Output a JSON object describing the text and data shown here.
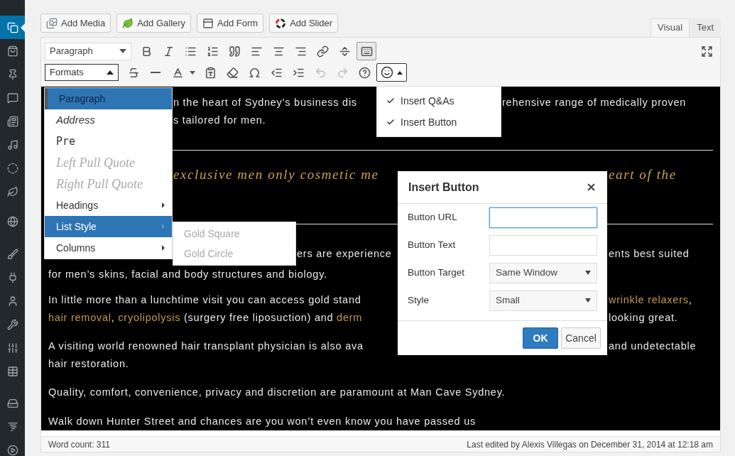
{
  "sidebar_menu": [
    {
      "selected": true
    },
    {
      "selected": false
    },
    {
      "selected": false
    },
    {
      "selected": false
    },
    {
      "selected": false
    },
    {
      "selected": false
    },
    {
      "selected": false
    },
    {
      "selected": false
    },
    {
      "selected": false
    },
    {
      "selected": false
    },
    {
      "selected": false
    },
    {
      "selected": false
    },
    {
      "selected": false
    },
    {
      "selected": false
    },
    {
      "selected": false
    },
    {
      "selected": false
    },
    {
      "selected": false
    },
    {
      "selected": false
    }
  ],
  "media_buttons": [
    "Add Media",
    "Add Gallery",
    "Add Form",
    "Add Slider"
  ],
  "editor_tabs": [
    {
      "label": "Visual",
      "selected": true
    },
    {
      "label": "Text",
      "selected": false
    }
  ],
  "toolbar": {
    "block_format": "Paragraph",
    "toolbar_toggle_pressed": true,
    "formats_select": {
      "label": "Formats",
      "open": true
    },
    "undo_disabled": true,
    "redo_disabled": true,
    "shortcodes_menu_open": true
  },
  "formats_menu": {
    "items": [
      {
        "label": "Paragraph",
        "kind": "paragraph",
        "selected": true,
        "highlighted": true
      },
      {
        "label": "Address",
        "kind": "address",
        "selected": false,
        "highlighted": false
      },
      {
        "label": "Pre",
        "kind": "pre",
        "selected": false,
        "highlighted": false
      },
      {
        "label": "Left Pull Quote",
        "kind": "pullquote",
        "selected": false,
        "highlighted": false
      },
      {
        "label": "Right Pull Quote",
        "kind": "pullquote",
        "selected": false,
        "highlighted": false
      },
      {
        "label": "Headings",
        "kind": "submenu",
        "selected": false,
        "highlighted": false
      },
      {
        "label": "List Style",
        "kind": "submenu",
        "selected": false,
        "highlighted": true
      },
      {
        "label": "Columns",
        "kind": "submenu",
        "selected": false,
        "highlighted": false
      }
    ]
  },
  "list_style_submenu": {
    "items": [
      {
        "label": "Gold Square",
        "disabled": true
      },
      {
        "label": "Gold Circle",
        "disabled": true
      }
    ]
  },
  "shortcodes_menu": {
    "items": [
      {
        "label": "Insert Q&As",
        "checked": true
      },
      {
        "label": "Insert Button",
        "checked": true
      }
    ]
  },
  "content": {
    "lines": [
      {
        "kind": "text",
        "left": [
          {
            "text": "n the heart of Sydney’s business dis",
            "link": false
          }
        ],
        "right": [
          {
            "text": "rehensive range of medically proven",
            "link": false
          }
        ]
      },
      {
        "kind": "text",
        "left": [
          {
            "text": "s tailored for men.",
            "link": false
          }
        ]
      },
      {
        "kind": "rule"
      },
      {
        "kind": "heading",
        "left": [
          {
            "text": "exclusive men only cosmetic me"
          }
        ],
        "right": [
          {
            "text": "eart of the"
          }
        ]
      },
      {
        "kind": "rule"
      },
      {
        "kind": "text",
        "left": [
          {
            "text": "ers are experience",
            "link": false
          }
        ],
        "right": [
          {
            "text": "ents best suited",
            "link": false
          }
        ]
      },
      {
        "kind": "text",
        "left": [
          {
            "text": "for men’s skins, facial and body structures and biology.",
            "link": false
          }
        ]
      },
      {
        "kind": "text",
        "left": [
          {
            "text": "In little more than a lunchtime visit you can access gold stand",
            "link": false
          }
        ],
        "right": [
          {
            "text": "wrinkle relaxers",
            "link": true
          },
          {
            "text": ",",
            "link": false
          }
        ]
      },
      {
        "kind": "text",
        "left": [
          {
            "text": "hair removal",
            "link": true
          },
          {
            "text": ", ",
            "link": false
          },
          {
            "text": "cryolipolysis",
            "link": true
          },
          {
            "text": " (surgery free liposuction) and ",
            "link": false
          },
          {
            "text": "derm",
            "link": true
          }
        ],
        "right": [
          {
            "text": "looking great.",
            "link": false
          }
        ]
      },
      {
        "kind": "text",
        "left": [
          {
            "text": "A visiting world renowned hair transplant physician is also ava",
            "link": false
          }
        ],
        "right": [
          {
            "text": "and undetectable",
            "link": false
          }
        ]
      },
      {
        "kind": "text",
        "left": [
          {
            "text": "hair restoration.",
            "link": false
          }
        ]
      },
      {
        "kind": "text",
        "left": [
          {
            "text": "Quality, comfort, convenience, privacy and discretion are paramount at Man Cave Sydney.",
            "link": false
          }
        ]
      },
      {
        "kind": "text",
        "left": [
          {
            "text": "Walk down Hunter Street and chances are you won’t even know you have passed us",
            "link": false
          }
        ]
      }
    ]
  },
  "dialog": {
    "title": "Insert Button",
    "fields": [
      {
        "label": "Button URL",
        "kind": "input",
        "focused": true
      },
      {
        "label": "Button Text",
        "kind": "input",
        "focused": false
      },
      {
        "label": "Button Target",
        "kind": "select",
        "value": "Same Window",
        "focused": false
      },
      {
        "label": "Style",
        "kind": "select",
        "value": "Small",
        "focused": false
      }
    ],
    "ok": "OK",
    "cancel": "Cancel"
  },
  "status_bar": {
    "word_count": "Word count: 311",
    "last_edited": "Last edited by Alexis Villegas on December 31, 2014 at 12:18 am"
  }
}
